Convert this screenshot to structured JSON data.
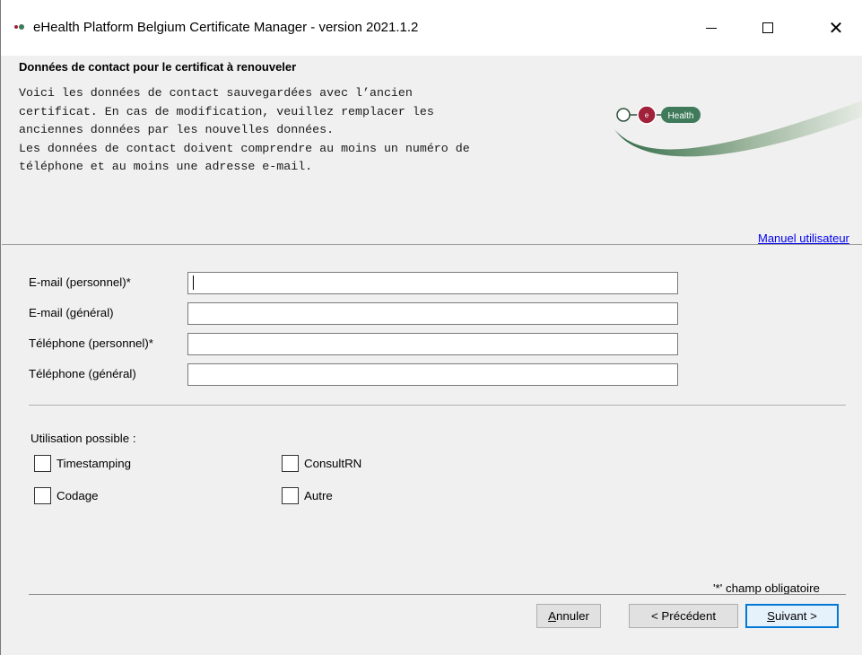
{
  "window": {
    "title": "eHealth Platform Belgium Certificate Manager - version 2021.1.2"
  },
  "header": {
    "title": "Données de contact pour le certificat à renouveler",
    "description": "Voici les données de contact sauvegardées avec l’ancien\ncertificat. En cas de modification, veuillez remplacer les\nanciennes données par les nouvelles données.\nLes données de contact doivent comprendre au moins un numéro de\ntéléphone et au moins une adresse e-mail.",
    "logo_text": "Health",
    "manual_link": "Manuel utilisateur"
  },
  "form": {
    "fields": [
      {
        "label": "E-mail (personnel)*",
        "value": ""
      },
      {
        "label": "E-mail (général)",
        "value": ""
      },
      {
        "label": "Téléphone (personnel)*",
        "value": ""
      },
      {
        "label": "Téléphone (général)",
        "value": ""
      }
    ]
  },
  "usage": {
    "label": "Utilisation possible :",
    "options": [
      {
        "label": "Timestamping",
        "checked": false
      },
      {
        "label": "ConsultRN",
        "checked": false
      },
      {
        "label": "Codage",
        "checked": false
      },
      {
        "label": "Autre",
        "checked": false
      }
    ]
  },
  "footer": {
    "required_note": "'*' champ obligatoire",
    "buttons": {
      "cancel_mnemonic": "A",
      "cancel_rest": "nnuler",
      "previous": "< Précédent",
      "next_mnemonic": "S",
      "next_rest": "uivant >"
    }
  },
  "colors": {
    "link": "#0000ee",
    "default_button_border": "#0078d7",
    "logo_green": "#3f7a5a",
    "logo_red": "#a1203a"
  }
}
